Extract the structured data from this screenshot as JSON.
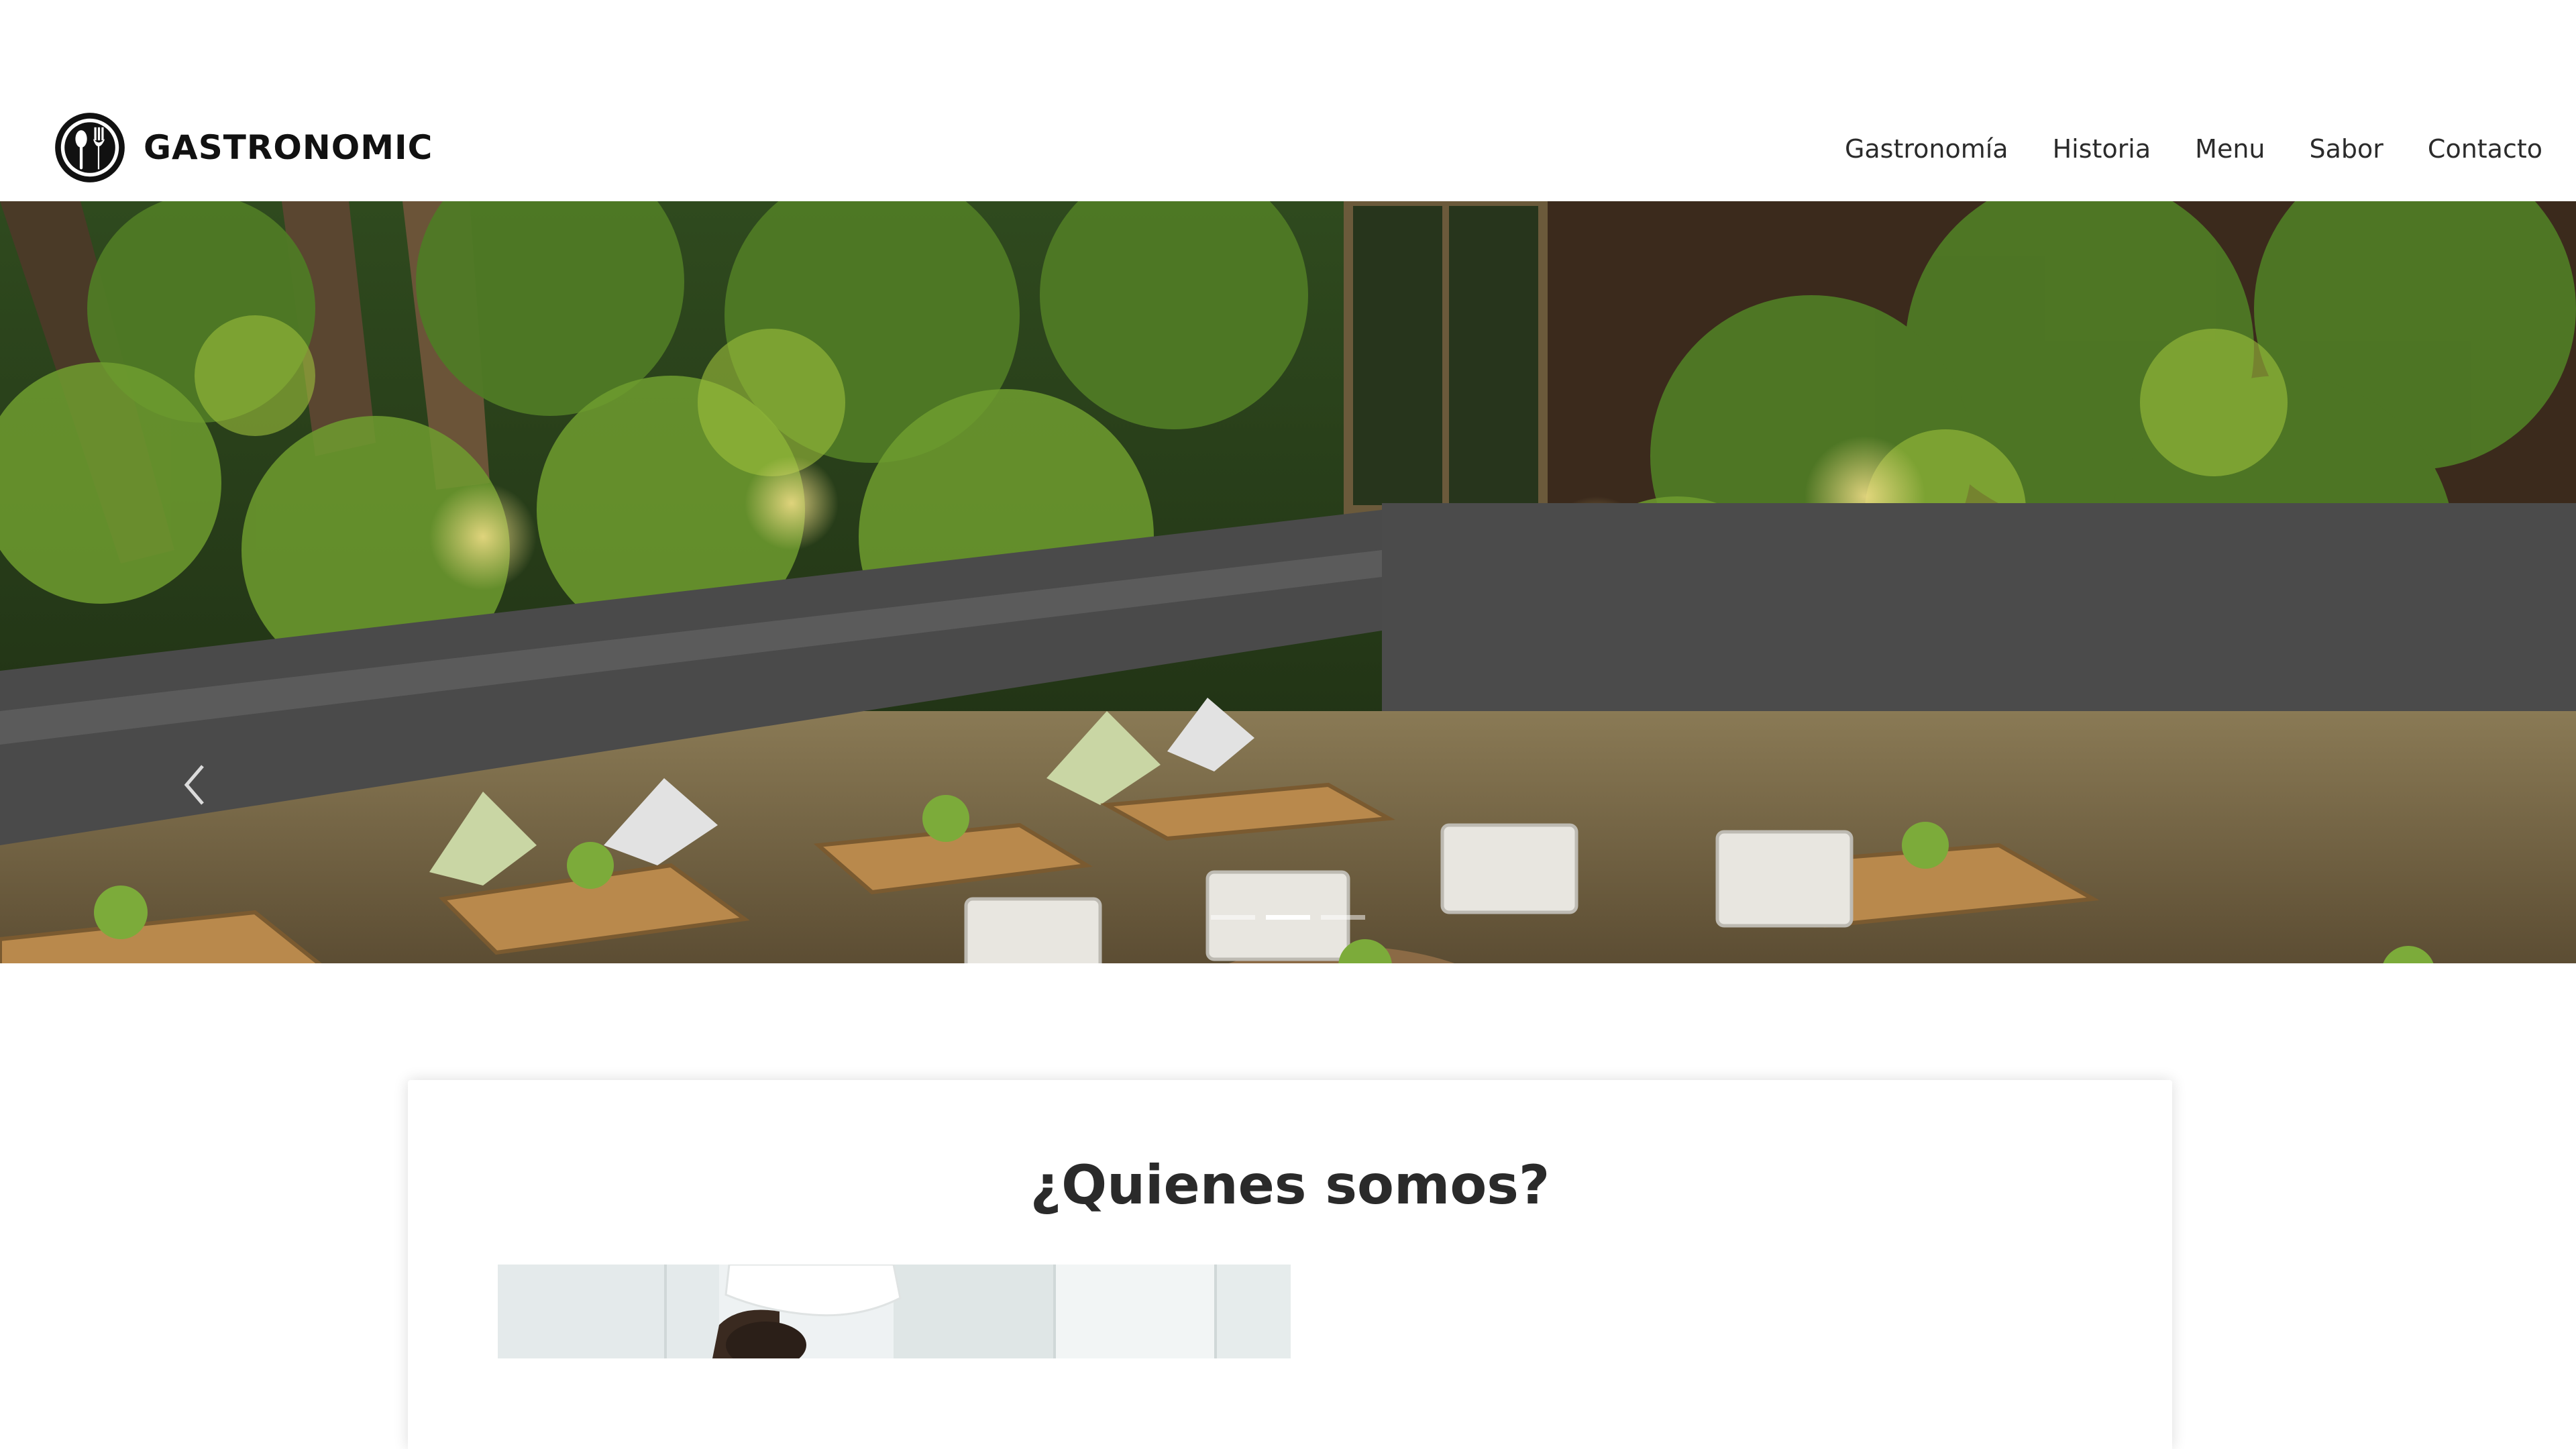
{
  "brand": {
    "name": "GASTRONOMIC",
    "logo_icon": "fork-spoon-icon"
  },
  "nav": {
    "items": [
      {
        "label": "Gastronomía"
      },
      {
        "label": "Historia"
      },
      {
        "label": "Menu"
      },
      {
        "label": "Sabor"
      },
      {
        "label": "Contacto"
      }
    ]
  },
  "hero": {
    "image_subject": "restaurant-terrace-photo",
    "prev_icon": "chevron-left-icon",
    "slides_total": 3,
    "active_slide": 2
  },
  "about": {
    "title": "¿Quienes somos?",
    "image_subject": "chef-photo"
  },
  "colors": {
    "background": "#ffffff",
    "text": "#2b2b2b",
    "brand_text": "#111111"
  }
}
